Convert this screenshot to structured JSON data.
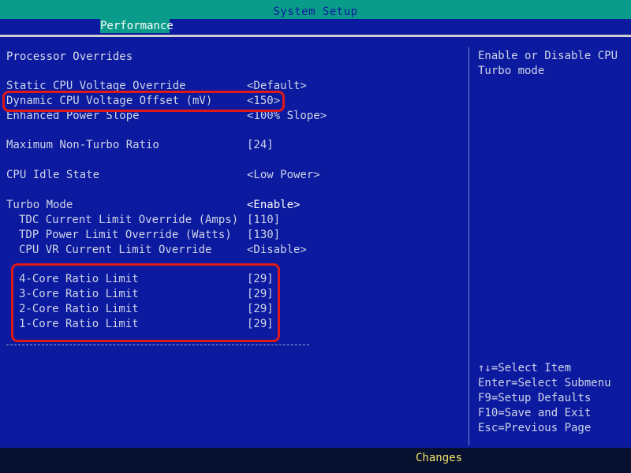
{
  "title": "System Setup",
  "tab": "Performance",
  "section_title": "Processor Overrides",
  "settings": [
    {
      "label": "Static CPU Voltage Override",
      "value": "<Default>"
    },
    {
      "label": "Dynamic CPU Voltage Offset (mV)",
      "value": "<150>"
    },
    {
      "label": "Enhanced Power Slope",
      "value": "<100% Slope>"
    },
    {
      "label": "Maximum Non-Turbo Ratio",
      "value": "[24]"
    },
    {
      "label": "CPU Idle State",
      "value": "<Low Power>"
    },
    {
      "label": "Turbo Mode",
      "value": "<Enable>"
    },
    {
      "label": "TDC Current Limit Override (Amps)",
      "value": "[110]"
    },
    {
      "label": "TDP Power Limit Override (Watts)",
      "value": "[130]"
    },
    {
      "label": "CPU VR Current Limit Override",
      "value": "<Disable>"
    },
    {
      "label": "4-Core Ratio Limit",
      "value": "[29]"
    },
    {
      "label": "3-Core Ratio Limit",
      "value": "[29]"
    },
    {
      "label": "2-Core Ratio Limit",
      "value": "[29]"
    },
    {
      "label": "1-Core Ratio Limit",
      "value": "[29]"
    }
  ],
  "separator": "------------------------------------------------",
  "help": {
    "line1": "Enable or Disable CPU",
    "line2": "Turbo mode"
  },
  "keys": [
    "↑↓=Select Item",
    "Enter=Select Submenu",
    "F9=Setup Defaults",
    "F10=Save and Exit",
    "Esc=Previous Page"
  ],
  "footer": "Changes",
  "colors": {
    "background": "#0b1a9e",
    "bar": "#0a9c8a",
    "highlight": "#e01818",
    "footer_text": "#f2e66a"
  }
}
